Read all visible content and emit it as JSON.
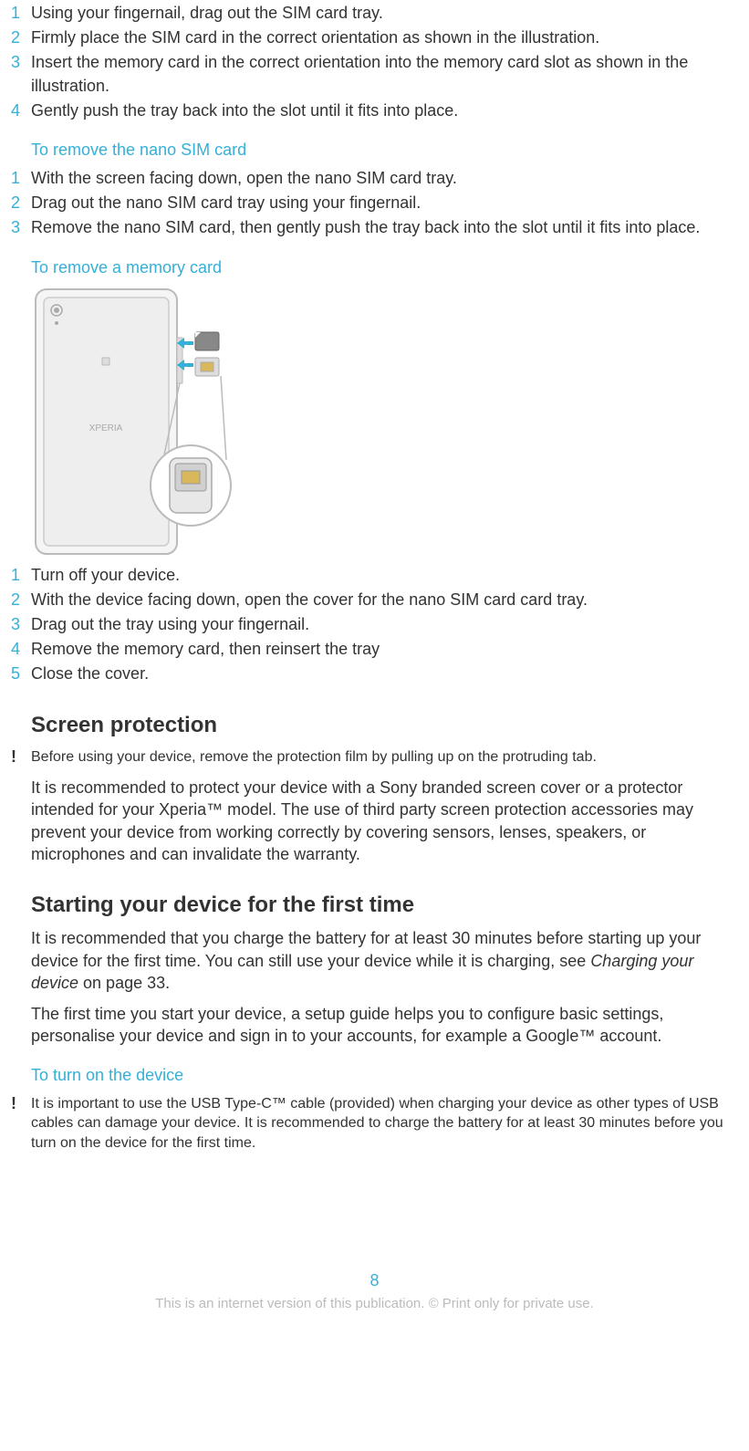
{
  "insert_steps": [
    {
      "n": "1",
      "t": "Using your fingernail, drag out the SIM card tray."
    },
    {
      "n": "2",
      "t": "Firmly place the SIM card in the correct orientation as shown in the illustration."
    },
    {
      "n": "3",
      "t": "Insert the memory card in the correct orientation into the memory card slot as shown in the illustration."
    },
    {
      "n": "4",
      "t": "Gently push the tray back into the slot until it fits into place."
    }
  ],
  "remove_sim_heading": "To remove the nano SIM card",
  "remove_sim_steps": [
    {
      "n": "1",
      "t": "With the screen facing down, open the nano SIM card tray."
    },
    {
      "n": "2",
      "t": "Drag out the nano SIM card tray using your fingernail."
    },
    {
      "n": "3",
      "t": "Remove the nano SIM card, then gently push the tray back into the slot until it fits into place."
    }
  ],
  "remove_mem_heading": "To remove a memory card",
  "remove_mem_steps": [
    {
      "n": "1",
      "t": "Turn off your device."
    },
    {
      "n": "2",
      "t": "With the device facing down, open the cover for the nano SIM card card tray."
    },
    {
      "n": "3",
      "t": "Drag out the tray using your fingernail."
    },
    {
      "n": "4",
      "t": "Remove the memory card, then reinsert the tray"
    },
    {
      "n": "5",
      "t": "Close the cover."
    }
  ],
  "screen_protection": {
    "heading": "Screen protection",
    "warn": "Before using your device, remove the protection film by pulling up on the protruding tab.",
    "para": "It is recommended to protect your device with a Sony branded screen cover or a protector intended for your Xperia™ model. The use of third party screen protection accessories may prevent your device from working correctly by covering sensors, lenses, speakers, or microphones and can invalidate the warranty."
  },
  "start_device": {
    "heading": "Starting your device for the first time",
    "para1_a": "It is recommended that you charge the battery for at least 30 minutes before starting up your device for the first time. You can still use your device while it is charging, see ",
    "para1_link": "Charging your device",
    "para1_b": " on page 33.",
    "para2": "The first time you start your device, a setup guide helps you to configure basic settings, personalise your device and sign in to your accounts, for example a Google™ account."
  },
  "turn_on": {
    "heading": "To turn on the device",
    "warn": "It is important to use the USB Type-C™ cable (provided) when charging your device as other types of USB cables can damage your device. It is recommended to charge the battery for at least 30 minutes before you turn on the device for the first time."
  },
  "page_number": "8",
  "footer": "This is an internet version of this publication. © Print only for private use."
}
